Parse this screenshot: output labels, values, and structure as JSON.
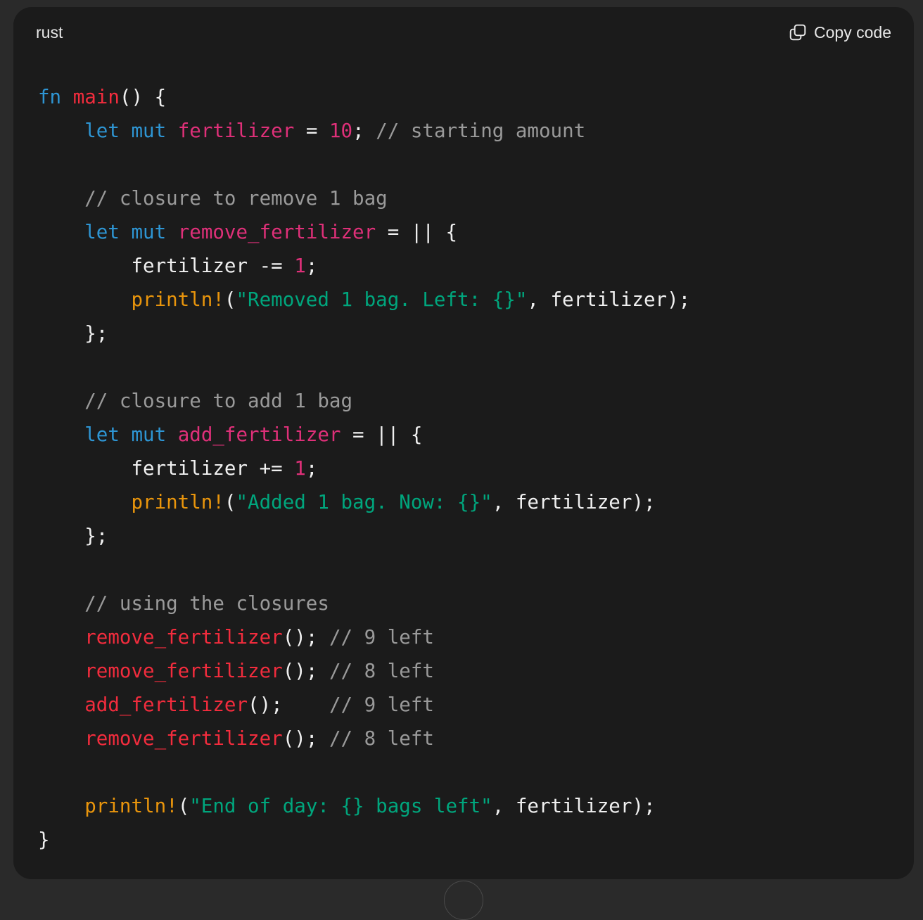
{
  "code_block": {
    "language": "rust",
    "copy_label": "Copy code",
    "copy_icon": "copy-icon",
    "lines": [
      [
        {
          "t": "fn",
          "c": "kw"
        },
        {
          "t": " ",
          "c": "plain"
        },
        {
          "t": "main",
          "c": "fnname"
        },
        {
          "t": "() {",
          "c": "plain"
        }
      ],
      [
        {
          "t": "    ",
          "c": "plain"
        },
        {
          "t": "let",
          "c": "kw"
        },
        {
          "t": " ",
          "c": "plain"
        },
        {
          "t": "mut",
          "c": "kw"
        },
        {
          "t": " ",
          "c": "plain"
        },
        {
          "t": "fertilizer",
          "c": "var"
        },
        {
          "t": " = ",
          "c": "plain"
        },
        {
          "t": "10",
          "c": "num"
        },
        {
          "t": "; ",
          "c": "plain"
        },
        {
          "t": "// starting amount",
          "c": "cmt"
        }
      ],
      [],
      [
        {
          "t": "    ",
          "c": "plain"
        },
        {
          "t": "// closure to remove 1 bag",
          "c": "cmt"
        }
      ],
      [
        {
          "t": "    ",
          "c": "plain"
        },
        {
          "t": "let",
          "c": "kw"
        },
        {
          "t": " ",
          "c": "plain"
        },
        {
          "t": "mut",
          "c": "kw"
        },
        {
          "t": " ",
          "c": "plain"
        },
        {
          "t": "remove_fertilizer",
          "c": "var"
        },
        {
          "t": " = || {",
          "c": "plain"
        }
      ],
      [
        {
          "t": "        fertilizer -= ",
          "c": "plain"
        },
        {
          "t": "1",
          "c": "num"
        },
        {
          "t": ";",
          "c": "plain"
        }
      ],
      [
        {
          "t": "        ",
          "c": "plain"
        },
        {
          "t": "println!",
          "c": "mac"
        },
        {
          "t": "(",
          "c": "plain"
        },
        {
          "t": "\"Removed 1 bag. Left: {}\"",
          "c": "str"
        },
        {
          "t": ", fertilizer);",
          "c": "plain"
        }
      ],
      [
        {
          "t": "    };",
          "c": "plain"
        }
      ],
      [],
      [
        {
          "t": "    ",
          "c": "plain"
        },
        {
          "t": "// closure to add 1 bag",
          "c": "cmt"
        }
      ],
      [
        {
          "t": "    ",
          "c": "plain"
        },
        {
          "t": "let",
          "c": "kw"
        },
        {
          "t": " ",
          "c": "plain"
        },
        {
          "t": "mut",
          "c": "kw"
        },
        {
          "t": " ",
          "c": "plain"
        },
        {
          "t": "add_fertilizer",
          "c": "var"
        },
        {
          "t": " = || {",
          "c": "plain"
        }
      ],
      [
        {
          "t": "        fertilizer += ",
          "c": "plain"
        },
        {
          "t": "1",
          "c": "num"
        },
        {
          "t": ";",
          "c": "plain"
        }
      ],
      [
        {
          "t": "        ",
          "c": "plain"
        },
        {
          "t": "println!",
          "c": "mac"
        },
        {
          "t": "(",
          "c": "plain"
        },
        {
          "t": "\"Added 1 bag. Now: {}\"",
          "c": "str"
        },
        {
          "t": ", fertilizer);",
          "c": "plain"
        }
      ],
      [
        {
          "t": "    };",
          "c": "plain"
        }
      ],
      [],
      [
        {
          "t": "    ",
          "c": "plain"
        },
        {
          "t": "// using the closures",
          "c": "cmt"
        }
      ],
      [
        {
          "t": "    ",
          "c": "plain"
        },
        {
          "t": "remove_fertilizer",
          "c": "fnname"
        },
        {
          "t": "(); ",
          "c": "plain"
        },
        {
          "t": "// 9 left",
          "c": "cmt"
        }
      ],
      [
        {
          "t": "    ",
          "c": "plain"
        },
        {
          "t": "remove_fertilizer",
          "c": "fnname"
        },
        {
          "t": "(); ",
          "c": "plain"
        },
        {
          "t": "// 8 left",
          "c": "cmt"
        }
      ],
      [
        {
          "t": "    ",
          "c": "plain"
        },
        {
          "t": "add_fertilizer",
          "c": "fnname"
        },
        {
          "t": "();    ",
          "c": "plain"
        },
        {
          "t": "// 9 left",
          "c": "cmt"
        }
      ],
      [
        {
          "t": "    ",
          "c": "plain"
        },
        {
          "t": "remove_fertilizer",
          "c": "fnname"
        },
        {
          "t": "(); ",
          "c": "plain"
        },
        {
          "t": "// 8 left",
          "c": "cmt"
        }
      ],
      [],
      [
        {
          "t": "    ",
          "c": "plain"
        },
        {
          "t": "println!",
          "c": "mac"
        },
        {
          "t": "(",
          "c": "plain"
        },
        {
          "t": "\"End of day: {} bags left\"",
          "c": "str"
        },
        {
          "t": ", fertilizer);",
          "c": "plain"
        }
      ],
      [
        {
          "t": "}",
          "c": "plain"
        }
      ]
    ]
  },
  "colors": {
    "background": "#1b1b1b",
    "keyword": "#2e95d3",
    "function": "#f22c3d",
    "variable": "#df3079",
    "comment": "#9a9a9a",
    "macro": "#e9950c",
    "string": "#00a67d"
  }
}
